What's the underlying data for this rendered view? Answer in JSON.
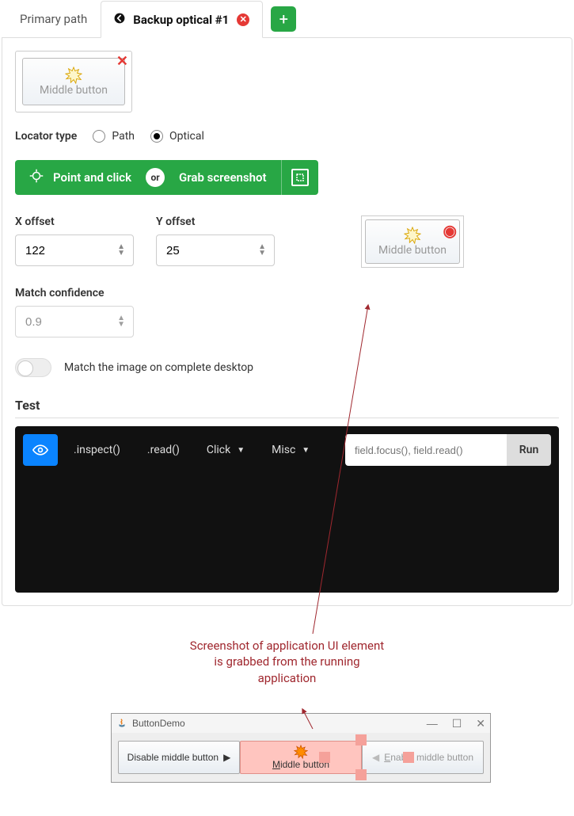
{
  "tabs": {
    "primary": "Primary path",
    "backup": "Backup optical #1"
  },
  "thumb": {
    "label": "Middle button"
  },
  "locator": {
    "label": "Locator type",
    "path": "Path",
    "optical": "Optical"
  },
  "actions": {
    "point": "Point and click",
    "or": "or",
    "grab": "Grab screenshot"
  },
  "offsets": {
    "x_label": "X offset",
    "x_value": "122",
    "y_label": "Y offset",
    "y_value": "25"
  },
  "preview": {
    "label": "Middle button"
  },
  "confidence": {
    "label": "Match confidence",
    "placeholder": "0.9"
  },
  "toggle": {
    "label": "Match the image on complete desktop"
  },
  "test": {
    "header": "Test",
    "inspect": ".inspect()",
    "read": ".read()",
    "click": "Click",
    "misc": "Misc",
    "placeholder": "field.focus(), field.read()",
    "run": "Run"
  },
  "annotation": "Screenshot of application UI element is grabbed from the running application",
  "demo": {
    "title": "ButtonDemo",
    "disable": "Disable middle button",
    "middle": "Middle button",
    "enable": "Enable middle button"
  }
}
